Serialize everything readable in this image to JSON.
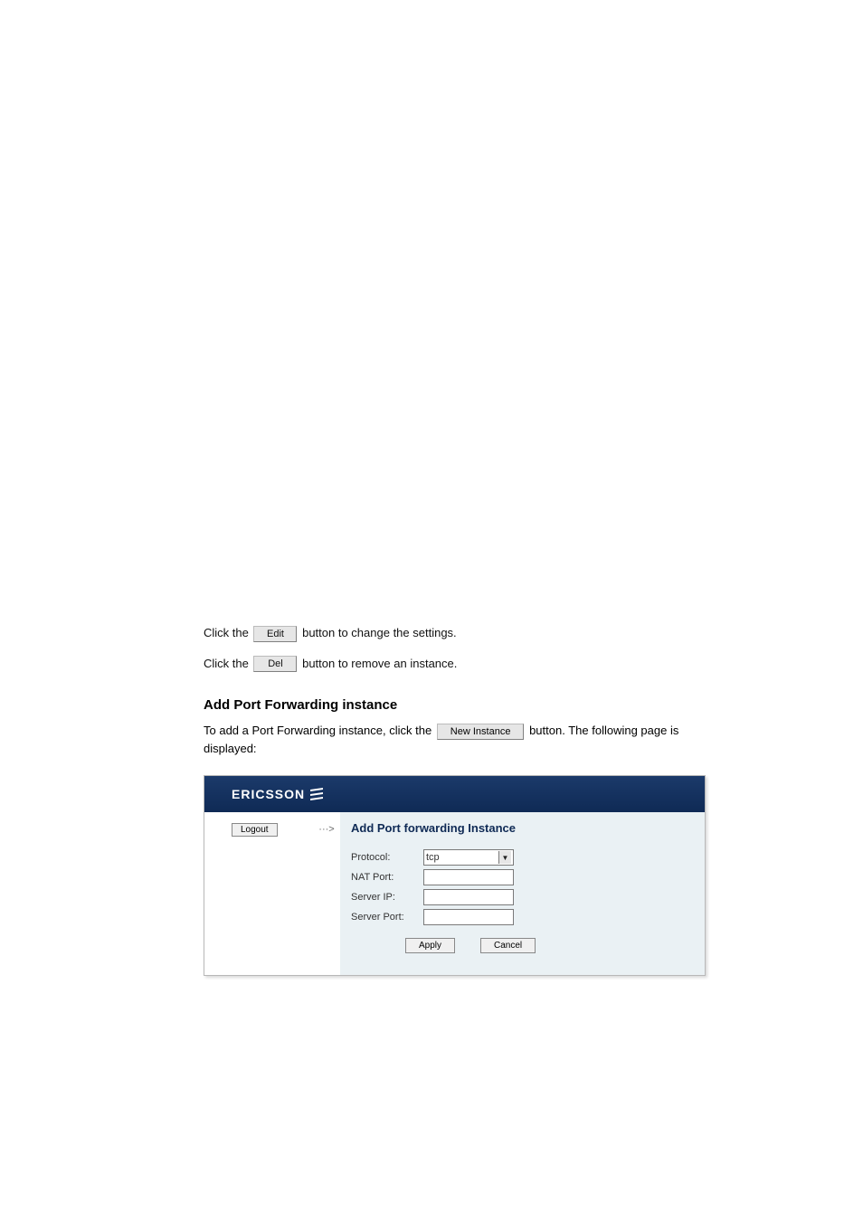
{
  "body": {
    "p1_prefix": "Click the ",
    "p1_editBtn": "Edit",
    "p1_mid": " button to change the settings.",
    "p2_prefix": "Click the ",
    "p2_delBtn": "Del",
    "p2_mid": " button to remove an instance.",
    "sectionTitle": "Add Port Forwarding instance",
    "sub_prefix": "To add a Port Forwarding instance, click the ",
    "sub_btn": "New Instance",
    "sub_suffix": " button. The following page is displayed:"
  },
  "ui": {
    "brand": "ERICSSON",
    "logout": "Logout",
    "arrow": "···>",
    "title": "Add Port forwarding Instance",
    "rows": {
      "protocol": {
        "label": "Protocol:",
        "value": "tcp"
      },
      "natport": {
        "label": "NAT Port:"
      },
      "serverip": {
        "label": "Server IP:"
      },
      "serverport": {
        "label": "Server Port:"
      }
    },
    "applyBtn": "Apply",
    "cancelBtn": "Cancel"
  }
}
